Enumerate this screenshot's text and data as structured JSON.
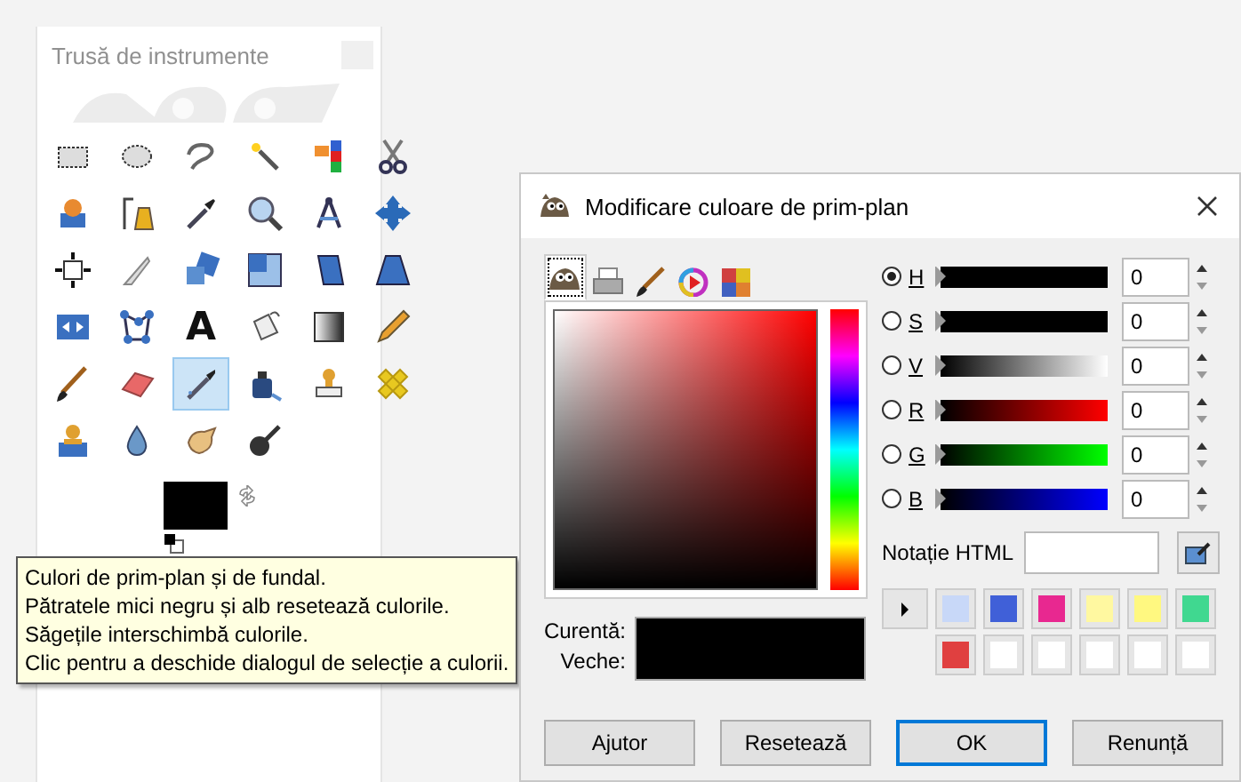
{
  "toolbox": {
    "title": "Trusă de instrumente",
    "tools": [
      {
        "selected": false
      },
      {
        "selected": false
      },
      {
        "selected": false
      },
      {
        "selected": false
      },
      {
        "selected": false
      },
      {
        "selected": false
      },
      {
        "selected": false
      },
      {
        "selected": false
      },
      {
        "selected": false
      },
      {
        "selected": false
      },
      {
        "selected": false
      },
      {
        "selected": false
      },
      {
        "selected": false
      },
      {
        "selected": false
      },
      {
        "selected": false
      },
      {
        "selected": false
      },
      {
        "selected": false
      },
      {
        "selected": false
      },
      {
        "selected": false
      },
      {
        "selected": false
      },
      {
        "selected": false,
        "glyph": "A"
      },
      {
        "selected": false
      },
      {
        "selected": false
      },
      {
        "selected": false
      },
      {
        "selected": false
      },
      {
        "selected": false
      },
      {
        "selected": true
      },
      {
        "selected": false
      },
      {
        "selected": false
      },
      {
        "selected": false
      },
      {
        "selected": false
      },
      {
        "selected": false
      },
      {
        "selected": false
      },
      {
        "selected": false
      }
    ],
    "color_swatches": [
      {
        "kind": "foreground",
        "color": "#000000"
      },
      {
        "kind": "background",
        "color": "#ffffff"
      }
    ]
  },
  "tooltip": {
    "lines": [
      "Culori de prim-plan și de fundal.",
      "Pătratele mici negru și alb resetează culorile.",
      "Săgețile interschimbă culorile.",
      "Clic pentru a deschide dialogul de selecție a culorii."
    ]
  },
  "dialog": {
    "title": "Modificare culoare de prim-plan",
    "tabs": [
      {
        "selected": true
      },
      {
        "selected": false
      },
      {
        "selected": false
      },
      {
        "selected": false
      },
      {
        "selected": false
      }
    ],
    "comparison": [
      {
        "label": "Curentă:",
        "color": "#000000"
      },
      {
        "label": "Veche:",
        "color": "#000000"
      }
    ],
    "channels": [
      {
        "label": "H",
        "selected": true,
        "kind": "hue",
        "level": 0,
        "value": "0"
      },
      {
        "label": "S",
        "selected": false,
        "kind": "saturation",
        "level": 0,
        "value": "0"
      },
      {
        "label": "V",
        "selected": false,
        "kind": "value",
        "level": 0,
        "value": "0"
      },
      {
        "label": "R",
        "selected": false,
        "kind": "red",
        "level": 0,
        "value": "0"
      },
      {
        "label": "G",
        "selected": false,
        "kind": "green",
        "level": 0,
        "value": "0"
      },
      {
        "label": "B",
        "selected": false,
        "kind": "blue",
        "level": 0,
        "value": "0"
      }
    ],
    "html_label": "Notație HTML",
    "history": [
      {
        "color": "#c8d8f8"
      },
      {
        "color": "#4060d8"
      },
      {
        "color": "#e82890"
      },
      {
        "color": "#fff8a0"
      },
      {
        "color": "#fff880"
      },
      {
        "color": "#40d890"
      },
      {
        "color": "#e04040"
      },
      {
        "color": "#ffffff"
      },
      {
        "color": "#ffffff"
      },
      {
        "color": "#ffffff"
      },
      {
        "color": "#ffffff"
      },
      {
        "color": "#ffffff"
      }
    ],
    "buttons": [
      {
        "label": "Ajutor",
        "default": false
      },
      {
        "label": "Resetează",
        "default": false
      },
      {
        "label": "OK",
        "default": true
      },
      {
        "label": "Renunță",
        "default": false
      }
    ]
  }
}
